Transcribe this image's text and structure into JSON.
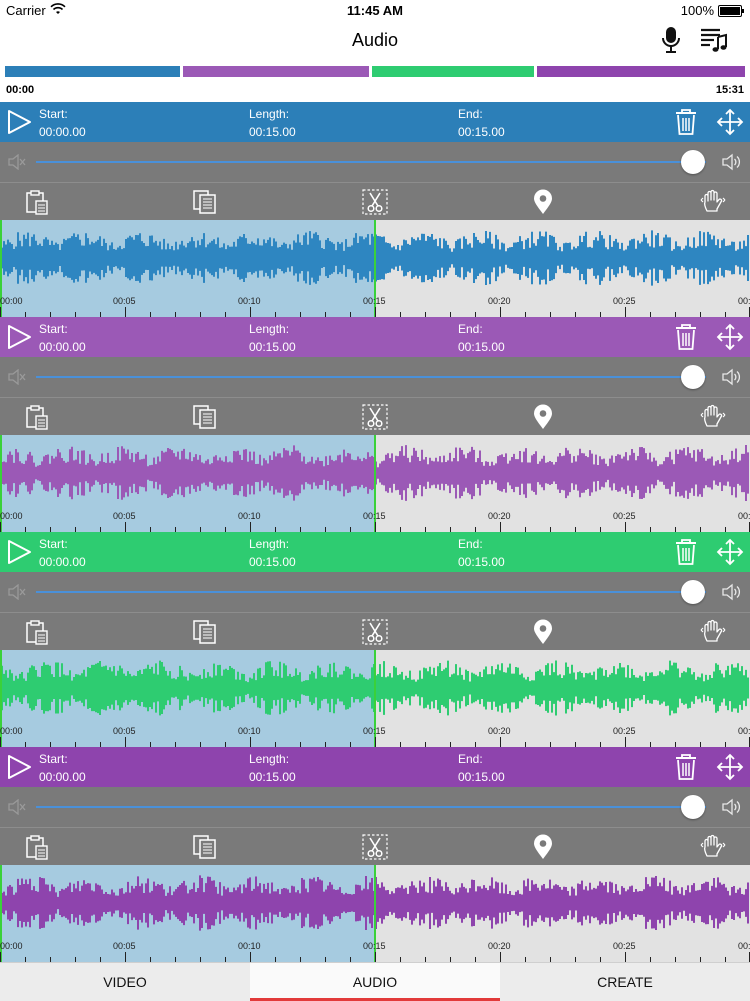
{
  "status": {
    "carrier": "Carrier",
    "time": "11:45 AM",
    "battery": "100%"
  },
  "nav": {
    "title": "Audio",
    "record_icon": "microphone-icon",
    "library_icon": "music-playlist-icon"
  },
  "overview": {
    "start_time": "00:00",
    "end_time": "15:31",
    "segments": [
      "#2c7fb8",
      "#9b59b6",
      "#2ecc71",
      "#8e44ad"
    ]
  },
  "labels": {
    "start": "Start:",
    "length": "Length:",
    "end": "End:"
  },
  "tick_labels": [
    "00:00",
    "00:05",
    "00:10",
    "00:15",
    "00:20",
    "00:25",
    "00:"
  ],
  "tracks": [
    {
      "color": "#2c7fb8",
      "wave_color": "#2e86c1",
      "start": "00:00.00",
      "length": "00:15.00",
      "end": "00:15.00",
      "volume": 0.98
    },
    {
      "color": "#9b59b6",
      "wave_color": "#9b59b6",
      "start": "00:00.00",
      "length": "00:15.00",
      "end": "00:15.00",
      "volume": 0.98
    },
    {
      "color": "#2ecc71",
      "wave_color": "#2ecc71",
      "start": "00:00.00",
      "length": "00:15.00",
      "end": "00:15.00",
      "volume": 0.98
    },
    {
      "color": "#8e44ad",
      "wave_color": "#8e44ad",
      "start": "00:00.00",
      "length": "00:15.00",
      "end": "00:15.00",
      "volume": 0.98
    }
  ],
  "tabs": [
    {
      "label": "VIDEO",
      "active": false
    },
    {
      "label": "AUDIO",
      "active": true
    },
    {
      "label": "CREATE",
      "active": false
    }
  ]
}
